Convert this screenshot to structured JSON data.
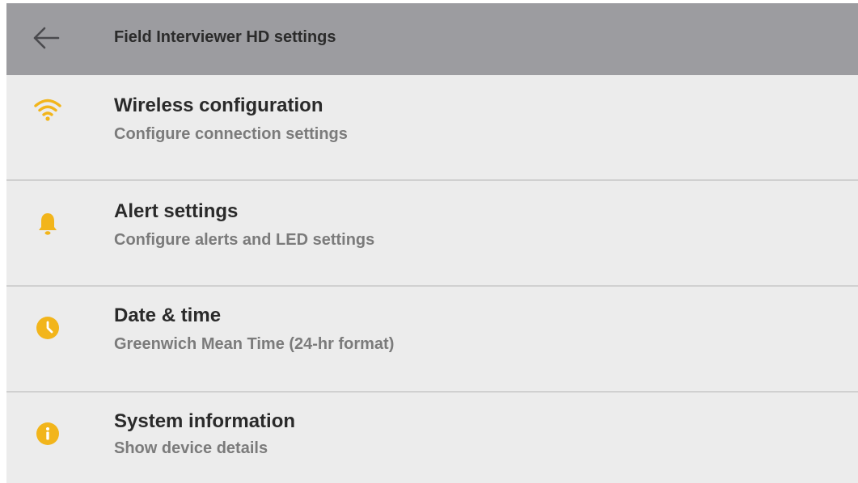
{
  "appbar": {
    "title": "Field Interviewer HD settings",
    "back_icon": "arrow-left-icon"
  },
  "colors": {
    "appbar_bg": "#9c9ca0",
    "list_bg": "#ececec",
    "accent": "#f2b51b",
    "title_text": "#2a2a2a",
    "subtitle_text": "#7b7b7b",
    "divider": "#d0d0d0"
  },
  "settings": {
    "items": [
      {
        "icon": "wifi-icon",
        "title": "Wireless configuration",
        "subtitle": "Configure connection settings"
      },
      {
        "icon": "bell-icon",
        "title": "Alert settings",
        "subtitle": "Configure alerts and LED settings"
      },
      {
        "icon": "clock-icon",
        "title": "Date & time",
        "subtitle": "Greenwich Mean Time (24-hr format)"
      },
      {
        "icon": "info-icon",
        "title": "System information",
        "subtitle": "Show device details"
      }
    ]
  }
}
